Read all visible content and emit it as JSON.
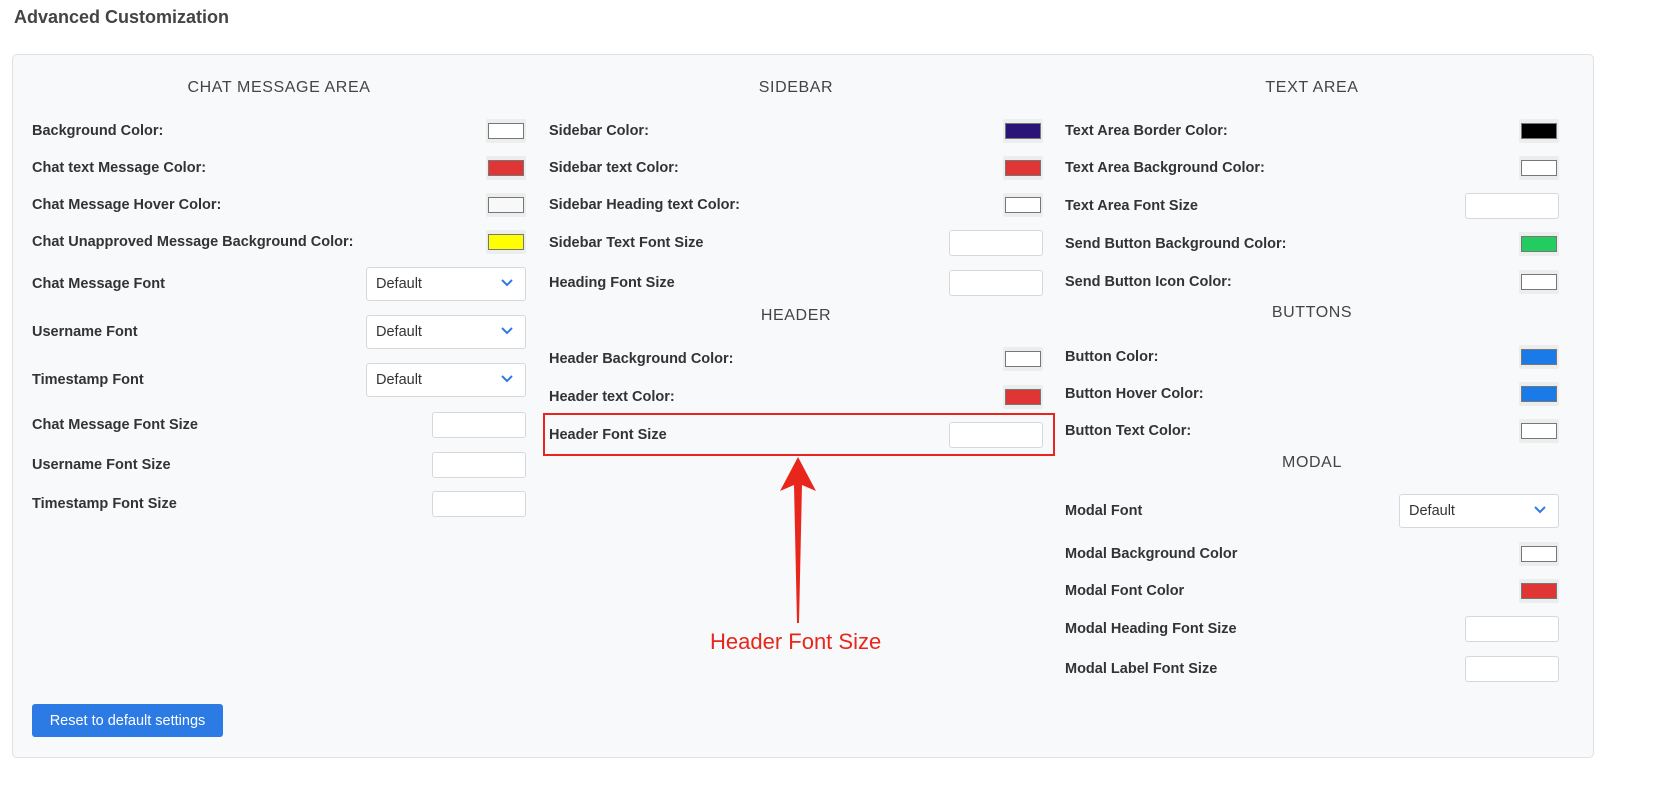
{
  "page_title": "Advanced Customization",
  "colors": {
    "accent": "#2c7be5",
    "annotation": "#e8261c"
  },
  "columns": [
    {
      "id": "col1",
      "sections": [
        {
          "heading": "CHAT MESSAGE AREA",
          "items": [
            {
              "label": "Background Color:",
              "type": "color",
              "value": "#ffffff"
            },
            {
              "label": "Chat text Message Color:",
              "type": "color",
              "value": "#e03535"
            },
            {
              "label": "Chat Message Hover Color:",
              "type": "color",
              "value": "#f8f8f8"
            },
            {
              "label": "Chat Unapproved Message Background Color:",
              "type": "color",
              "value": "#ffff00"
            },
            {
              "label": "Chat Message Font",
              "type": "select",
              "value": "Default"
            },
            {
              "label": "Username Font",
              "type": "select",
              "value": "Default"
            },
            {
              "label": "Timestamp Font",
              "type": "select",
              "value": "Default"
            },
            {
              "label": "Chat Message Font Size",
              "type": "input",
              "value": ""
            },
            {
              "label": "Username Font Size",
              "type": "input",
              "value": ""
            },
            {
              "label": "Timestamp Font Size",
              "type": "input",
              "value": ""
            }
          ]
        }
      ]
    },
    {
      "id": "col2",
      "sections": [
        {
          "heading": "SIDEBAR",
          "items": [
            {
              "label": "Sidebar Color:",
              "type": "color",
              "value": "#2b1478"
            },
            {
              "label": "Sidebar text Color:",
              "type": "color",
              "value": "#e03535"
            },
            {
              "label": "Sidebar Heading text Color:",
              "type": "color",
              "value": "#ffffff"
            },
            {
              "label": "Sidebar Text Font Size",
              "type": "input",
              "value": ""
            },
            {
              "label": "Heading Font Size",
              "type": "input",
              "value": ""
            }
          ]
        },
        {
          "heading": "HEADER",
          "items": [
            {
              "label": "Header Background Color:",
              "type": "color",
              "value": "#ffffff"
            },
            {
              "label": "Header text Color:",
              "type": "color",
              "value": "#e03535"
            },
            {
              "label": "Header Font Size",
              "type": "input",
              "value": ""
            }
          ]
        }
      ]
    },
    {
      "id": "col3",
      "sections": [
        {
          "heading": "TEXT AREA",
          "items": [
            {
              "label": "Text Area Border Color:",
              "type": "color",
              "value": "#000000"
            },
            {
              "label": "Text Area Background Color:",
              "type": "color",
              "value": "#ffffff"
            },
            {
              "label": "Text Area Font Size",
              "type": "input",
              "value": ""
            },
            {
              "label": "Send Button Background Color:",
              "type": "color",
              "value": "#22cc5e"
            },
            {
              "label": "Send Button Icon Color:",
              "type": "color",
              "value": "#ffffff"
            }
          ]
        },
        {
          "heading": "BUTTONS",
          "items": [
            {
              "label": "Button Color:",
              "type": "color",
              "value": "#1a7ae8"
            },
            {
              "label": "Button Hover Color:",
              "type": "color",
              "value": "#1a7ae8"
            },
            {
              "label": "Button Text Color:",
              "type": "color",
              "value": "#ffffff"
            }
          ]
        },
        {
          "heading": "MODAL",
          "items": [
            {
              "label": "Modal Font",
              "type": "select",
              "value": "Default"
            },
            {
              "label": "Modal Background Color",
              "type": "color",
              "value": "#ffffff"
            },
            {
              "label": "Modal Font Color",
              "type": "color",
              "value": "#e03535"
            },
            {
              "label": "Modal Heading Font Size",
              "type": "input",
              "value": ""
            },
            {
              "label": "Modal Label Font Size",
              "type": "input",
              "value": ""
            }
          ]
        }
      ]
    }
  ],
  "reset_button": "Reset to default settings",
  "annotation": "Header Font Size"
}
